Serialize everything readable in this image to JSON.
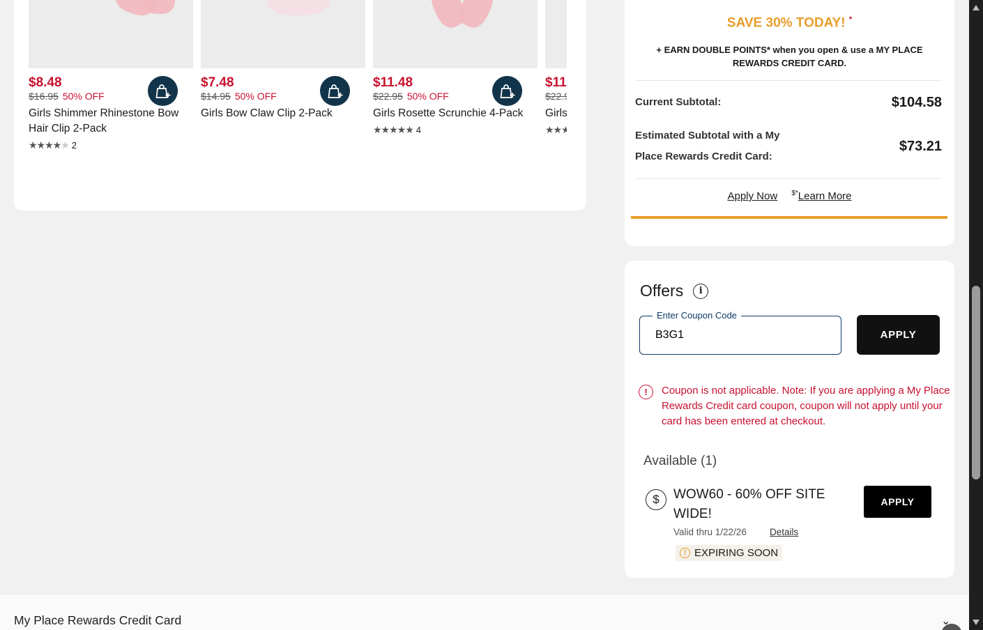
{
  "products": [
    {
      "price": "$8.48",
      "was": "$16.95",
      "off": "50% OFF",
      "name": "Girls Shimmer Rhinestone Bow Hair Clip 2-Pack",
      "stars": 4,
      "reviews": "2"
    },
    {
      "price": "$7.48",
      "was": "$14.95",
      "off": "50% OFF",
      "name": "Girls Bow Claw Clip 2-Pack",
      "stars": 0,
      "reviews": ""
    },
    {
      "price": "$11.48",
      "was": "$22.95",
      "off": "50% OFF",
      "name": "Girls Rosette Scrunchie 4-Pack",
      "stars": 5,
      "reviews": "4"
    },
    {
      "price": "$11",
      "was": "$22.9",
      "off": "",
      "name": "Girls",
      "stars": 3,
      "reviews": ""
    }
  ],
  "promo": {
    "title": "SAVE 30% TODAY!",
    "title_mark": "*",
    "earn": "+ EARN DOUBLE POINTS* when you open & use a MY PLACE REWARDS CREDIT CARD.",
    "current_label": "Current Subtotal:",
    "current_value": "$104.58",
    "est_label": "Estimated Subtotal with a My Place Rewards Credit Card:",
    "est_value": "$73.21",
    "apply_now": "Apply Now",
    "learn_mark": "$*",
    "learn_more": "Learn More"
  },
  "offers": {
    "title": "Offers",
    "coupon_label": "Enter Coupon Code",
    "coupon_value": "B3G1",
    "apply_label": "APPLY",
    "error": "Coupon is not applicable. Note: If you are applying a My Place Rewards Credit card coupon, coupon will not apply until your card has been entered at checkout.",
    "available": "Available (1)",
    "item": {
      "name": "WOW60 - 60% OFF SITE WIDE!",
      "valid": "Valid thru 1/22/26",
      "details": "Details",
      "badge": "EXPIRING SOON",
      "apply_label": "APPLY"
    }
  },
  "accordion": {
    "title": "My Place Rewards Credit Card"
  },
  "colors": {
    "price_red": "#c8102e",
    "accent_orange": "#e89d2a",
    "bag_navy": "#12344a"
  }
}
